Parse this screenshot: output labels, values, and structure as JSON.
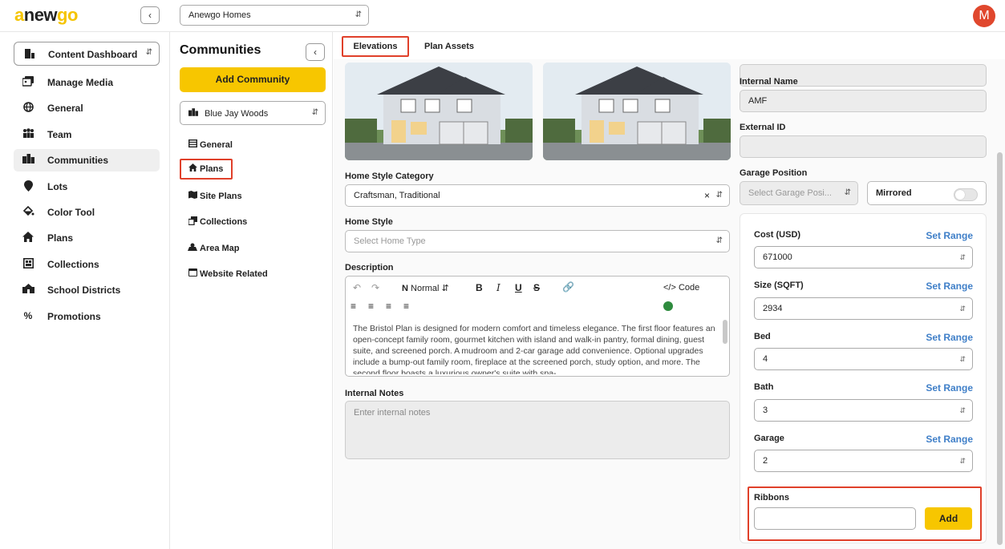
{
  "topbar": {
    "logo": {
      "part1": "a",
      "part2": "new",
      "part3": "go"
    },
    "builder_select": "Anewgo Homes",
    "avatar_initial": "M"
  },
  "sidebar": {
    "dashboard_label": "Content Dashboard",
    "items": [
      {
        "label": "Manage Media",
        "icon": "media-icon"
      },
      {
        "label": "General",
        "icon": "globe-icon"
      },
      {
        "label": "Team",
        "icon": "team-icon"
      },
      {
        "label": "Communities",
        "icon": "communities-icon"
      },
      {
        "label": "Lots",
        "icon": "pin-icon"
      },
      {
        "label": "Color Tool",
        "icon": "paint-bucket-icon"
      },
      {
        "label": "Plans",
        "icon": "home-icon"
      },
      {
        "label": "Collections",
        "icon": "collections-icon"
      },
      {
        "label": "School Districts",
        "icon": "school-icon"
      },
      {
        "label": "Promotions",
        "icon": "percent-icon"
      }
    ]
  },
  "communities": {
    "title": "Communities",
    "add_button": "Add Community",
    "selected_community": "Blue Jay Woods",
    "items": [
      {
        "label": "General",
        "icon": "list-icon"
      },
      {
        "label": "Plans",
        "icon": "home-icon"
      },
      {
        "label": "Site Plans",
        "icon": "map-icon"
      },
      {
        "label": "Collections",
        "icon": "collections-icon"
      },
      {
        "label": "Area Map",
        "icon": "area-map-icon"
      },
      {
        "label": "Website Related",
        "icon": "window-icon"
      }
    ]
  },
  "tabs": [
    "Elevations",
    "Plan Assets"
  ],
  "form": {
    "home_style_category_label": "Home Style Category",
    "home_style_category_value": "Craftsman, Traditional",
    "home_style_label": "Home Style",
    "home_style_placeholder": "Select Home Type",
    "description_label": "Description",
    "toolbar": {
      "normal": "Normal",
      "code": "</> Code"
    },
    "description_text": "The Bristol Plan is designed for modern comfort and timeless elegance. The first floor features an open-concept family room, gourmet kitchen with island and walk-in pantry, formal dining, guest suite, and screened porch. A mudroom and 2-car garage add convenience. Optional upgrades include a bump-out family room, fireplace at the screened porch, study option, and more. The second floor boasts a luxurious owner's suite with spa-",
    "internal_notes_label": "Internal Notes",
    "internal_notes_placeholder": "Enter internal notes",
    "internal_name_label": "Internal Name",
    "internal_name_value": "AMF",
    "external_id_label": "External ID",
    "external_id_value": "",
    "garage_position_label": "Garage Position",
    "garage_position_placeholder": "Select Garage Posi...",
    "mirrored_label": "Mirrored"
  },
  "ranges": {
    "set_range_label": "Set Range",
    "fields": [
      {
        "label": "Cost (USD)",
        "value": "671000"
      },
      {
        "label": "Size (SQFT)",
        "value": "2934"
      },
      {
        "label": "Bed",
        "value": "4"
      },
      {
        "label": "Bath",
        "value": "3"
      },
      {
        "label": "Garage",
        "value": "2"
      }
    ]
  },
  "ribbons": {
    "label": "Ribbons",
    "add_button": "Add"
  }
}
